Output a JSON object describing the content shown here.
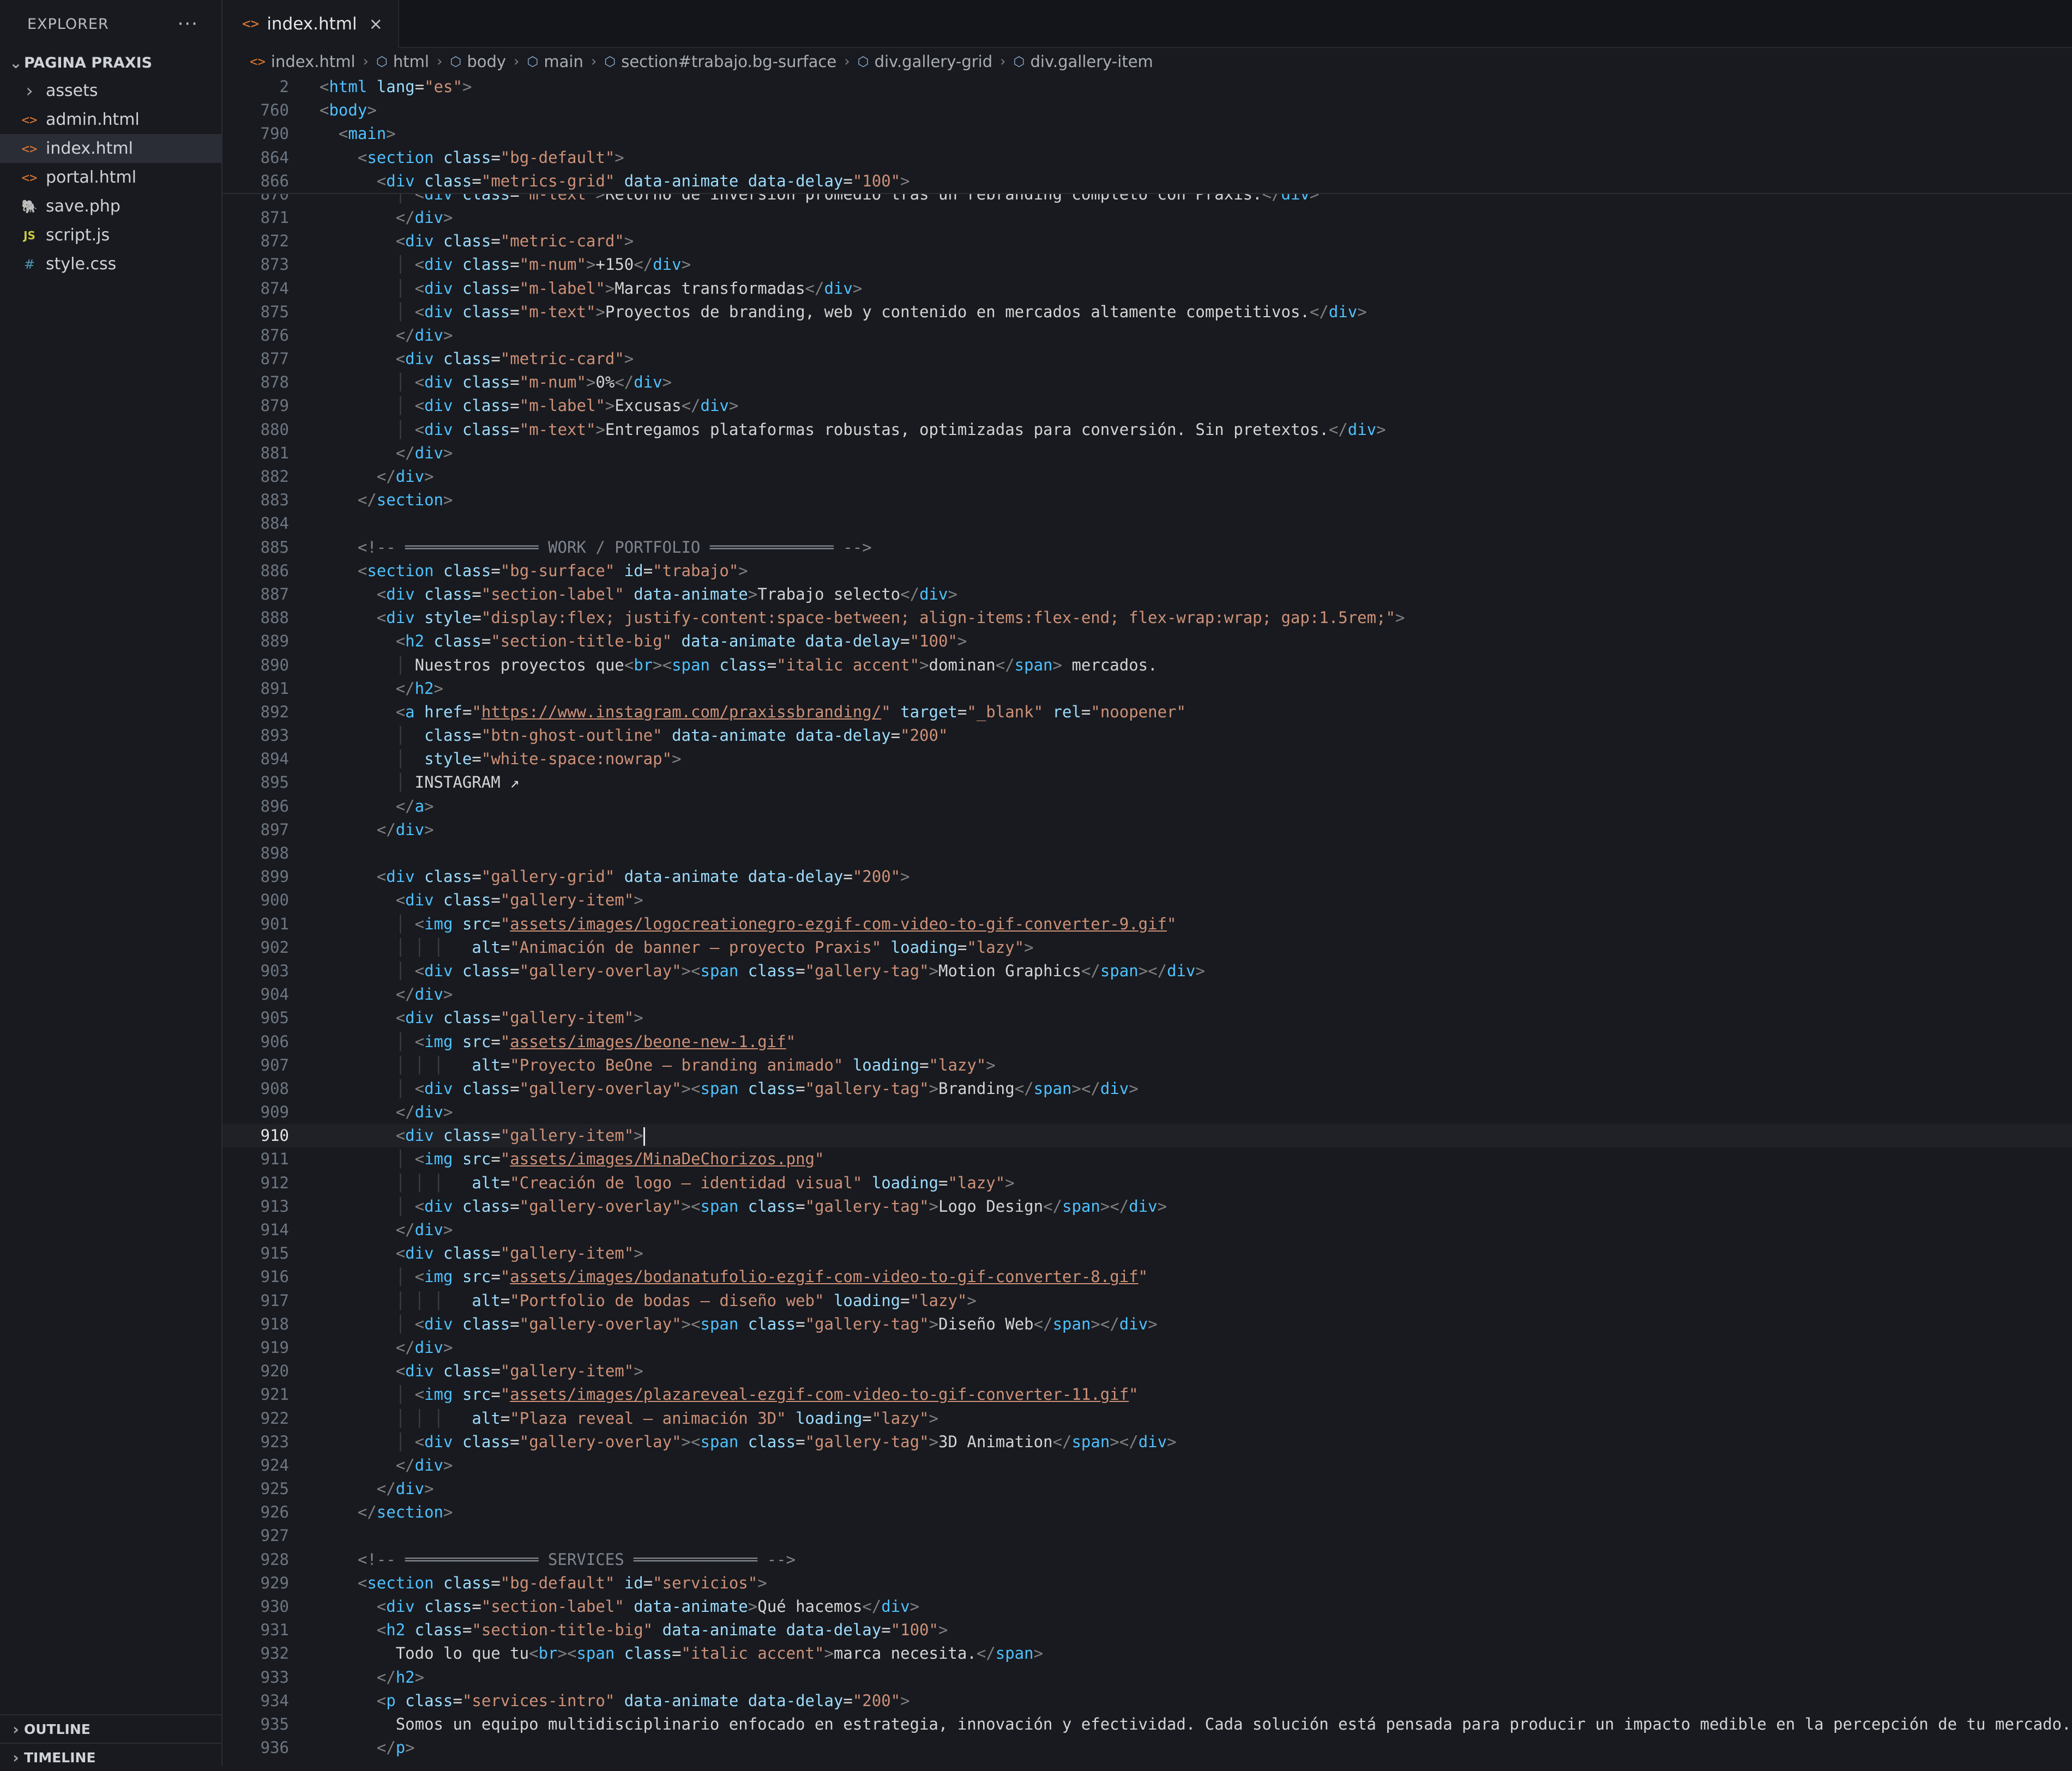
{
  "sidebar": {
    "title": "EXPLORER",
    "more": "···",
    "project": "PAGINA PRAXIS",
    "items": [
      {
        "name": "assets",
        "icon": "chevron-right-icon",
        "glyph": "›",
        "color": "#a0a4ab"
      },
      {
        "name": "admin.html",
        "icon": "html-icon",
        "glyph": "<>",
        "color": "#e37933"
      },
      {
        "name": "index.html",
        "icon": "html-icon",
        "glyph": "<>",
        "color": "#e37933"
      },
      {
        "name": "portal.html",
        "icon": "html-icon",
        "glyph": "<>",
        "color": "#e37933"
      },
      {
        "name": "save.php",
        "icon": "php-elephant-icon",
        "glyph": "🐘",
        "color": "#a074c4"
      },
      {
        "name": "script.js",
        "icon": "js-icon",
        "glyph": "JS",
        "color": "#cbcb41"
      },
      {
        "name": "style.css",
        "icon": "css-hash-icon",
        "glyph": "#",
        "color": "#519aba"
      }
    ],
    "active_index": 2,
    "outline": "OUTLINE",
    "timeline": "TIMELINE"
  },
  "tab": {
    "label": "index.html",
    "icon_glyph": "<>",
    "close": "×"
  },
  "breadcrumb": [
    {
      "label": "index.html",
      "icon": "html-icon"
    },
    {
      "label": "html",
      "icon": "element-icon"
    },
    {
      "label": "body",
      "icon": "element-icon"
    },
    {
      "label": "main",
      "icon": "element-icon"
    },
    {
      "label": "section#trabajo.bg-surface",
      "icon": "element-icon"
    },
    {
      "label": "div.gallery-grid",
      "icon": "element-icon"
    },
    {
      "label": "div.gallery-item",
      "icon": "element-icon"
    }
  ],
  "sticky_lines": [
    {
      "n": "2",
      "indent": 0,
      "code": "<html lang=\"es\">"
    },
    {
      "n": "760",
      "indent": 0,
      "code": "<body>"
    },
    {
      "n": "790",
      "indent": 1,
      "code": "<main>"
    },
    {
      "n": "864",
      "indent": 2,
      "code": "<section class=\"bg-default\">"
    },
    {
      "n": "866",
      "indent": 3,
      "code": "<div class=\"metrics-grid\" data-animate data-delay=\"100\">"
    }
  ],
  "partial_line": {
    "n": "870",
    "indent": 5,
    "code": "<div class=\"m-text\">Retorno de inversión promedio tras un rebranding completo con Praxis.</div>"
  },
  "current_line": "910",
  "lines": [
    {
      "n": "871",
      "indent": 4,
      "code": "</div>"
    },
    {
      "n": "872",
      "indent": 4,
      "code": "<div class=\"metric-card\">"
    },
    {
      "n": "873",
      "indent": 5,
      "code": "<div class=\"m-num\">+150</div>"
    },
    {
      "n": "874",
      "indent": 5,
      "code": "<div class=\"m-label\">Marcas transformadas</div>"
    },
    {
      "n": "875",
      "indent": 5,
      "code": "<div class=\"m-text\">Proyectos de branding, web y contenido en mercados altamente competitivos.</div>"
    },
    {
      "n": "876",
      "indent": 4,
      "code": "</div>"
    },
    {
      "n": "877",
      "indent": 4,
      "code": "<div class=\"metric-card\">"
    },
    {
      "n": "878",
      "indent": 5,
      "code": "<div class=\"m-num\">0%</div>"
    },
    {
      "n": "879",
      "indent": 5,
      "code": "<div class=\"m-label\">Excusas</div>"
    },
    {
      "n": "880",
      "indent": 5,
      "code": "<div class=\"m-text\">Entregamos plataformas robustas, optimizadas para conversión. Sin pretextos.</div>"
    },
    {
      "n": "881",
      "indent": 4,
      "code": "</div>"
    },
    {
      "n": "882",
      "indent": 3,
      "code": "</div>"
    },
    {
      "n": "883",
      "indent": 2,
      "code": "</section>"
    },
    {
      "n": "884",
      "indent": 0,
      "code": ""
    },
    {
      "n": "885",
      "indent": 2,
      "code": "<!-- ══════════════ WORK / PORTFOLIO ═════════════ -->"
    },
    {
      "n": "886",
      "indent": 2,
      "code": "<section class=\"bg-surface\" id=\"trabajo\">"
    },
    {
      "n": "887",
      "indent": 3,
      "code": "<div class=\"section-label\" data-animate>Trabajo selecto</div>"
    },
    {
      "n": "888",
      "indent": 3,
      "code": "<div style=\"display:flex; justify-content:space-between; align-items:flex-end; flex-wrap:wrap; gap:1.5rem;\">"
    },
    {
      "n": "889",
      "indent": 4,
      "code": "<h2 class=\"section-title-big\" data-animate data-delay=\"100\">"
    },
    {
      "n": "890",
      "indent": 5,
      "code": "Nuestros proyectos que<br><span class=\"italic accent\">dominan</span> mercados."
    },
    {
      "n": "891",
      "indent": 4,
      "code": "</h2>"
    },
    {
      "n": "892",
      "indent": 4,
      "code": "<a href=\"https://www.instagram.com/praxissbranding/\" target=\"_blank\" rel=\"noopener\""
    },
    {
      "n": "893",
      "indent": 5,
      "pad": " ",
      "code": "class=\"btn-ghost-outline\" data-animate data-delay=\"200\""
    },
    {
      "n": "894",
      "indent": 5,
      "pad": " ",
      "code": "style=\"white-space:nowrap\">"
    },
    {
      "n": "895",
      "indent": 5,
      "code": "INSTAGRAM ↗"
    },
    {
      "n": "896",
      "indent": 4,
      "code": "</a>"
    },
    {
      "n": "897",
      "indent": 3,
      "code": "</div>"
    },
    {
      "n": "898",
      "indent": 0,
      "code": ""
    },
    {
      "n": "899",
      "indent": 3,
      "code": "<div class=\"gallery-grid\" data-animate data-delay=\"200\">"
    },
    {
      "n": "900",
      "indent": 4,
      "code": "<div class=\"gallery-item\">"
    },
    {
      "n": "901",
      "indent": 5,
      "code": "<img src=\"assets/images/logocreationegro-ezgif-com-video-to-gif-converter-9.gif\""
    },
    {
      "n": "902",
      "indent": 7,
      "pad": "  ",
      "code": "alt=\"Animación de banner — proyecto Praxis\" loading=\"lazy\">"
    },
    {
      "n": "903",
      "indent": 5,
      "code": "<div class=\"gallery-overlay\"><span class=\"gallery-tag\">Motion Graphics</span></div>"
    },
    {
      "n": "904",
      "indent": 4,
      "code": "</div>"
    },
    {
      "n": "905",
      "indent": 4,
      "code": "<div class=\"gallery-item\">"
    },
    {
      "n": "906",
      "indent": 5,
      "code": "<img src=\"assets/images/beone-new-1.gif\""
    },
    {
      "n": "907",
      "indent": 7,
      "pad": "  ",
      "code": "alt=\"Proyecto BeOne — branding animado\" loading=\"lazy\">"
    },
    {
      "n": "908",
      "indent": 5,
      "code": "<div class=\"gallery-overlay\"><span class=\"gallery-tag\">Branding</span></div>"
    },
    {
      "n": "909",
      "indent": 4,
      "code": "</div>"
    },
    {
      "n": "910",
      "indent": 4,
      "code": "<div class=\"gallery-item\">",
      "cursor": true
    },
    {
      "n": "911",
      "indent": 5,
      "code": "<img src=\"assets/images/MinaDeChorizos.png\""
    },
    {
      "n": "912",
      "indent": 7,
      "pad": "  ",
      "code": "alt=\"Creación de logo — identidad visual\" loading=\"lazy\">"
    },
    {
      "n": "913",
      "indent": 5,
      "code": "<div class=\"gallery-overlay\"><span class=\"gallery-tag\">Logo Design</span></div>"
    },
    {
      "n": "914",
      "indent": 4,
      "code": "</div>"
    },
    {
      "n": "915",
      "indent": 4,
      "code": "<div class=\"gallery-item\">"
    },
    {
      "n": "916",
      "indent": 5,
      "code": "<img src=\"assets/images/bodanatufolio-ezgif-com-video-to-gif-converter-8.gif\""
    },
    {
      "n": "917",
      "indent": 7,
      "pad": "  ",
      "code": "alt=\"Portfolio de bodas — diseño web\" loading=\"lazy\">"
    },
    {
      "n": "918",
      "indent": 5,
      "code": "<div class=\"gallery-overlay\"><span class=\"gallery-tag\">Diseño Web</span></div>"
    },
    {
      "n": "919",
      "indent": 4,
      "code": "</div>"
    },
    {
      "n": "920",
      "indent": 4,
      "code": "<div class=\"gallery-item\">"
    },
    {
      "n": "921",
      "indent": 5,
      "code": "<img src=\"assets/images/plazareveal-ezgif-com-video-to-gif-converter-11.gif\""
    },
    {
      "n": "922",
      "indent": 7,
      "pad": "  ",
      "code": "alt=\"Plaza reveal — animación 3D\" loading=\"lazy\">"
    },
    {
      "n": "923",
      "indent": 5,
      "code": "<div class=\"gallery-overlay\"><span class=\"gallery-tag\">3D Animation</span></div>"
    },
    {
      "n": "924",
      "indent": 4,
      "code": "</div>"
    },
    {
      "n": "925",
      "indent": 3,
      "code": "</div>"
    },
    {
      "n": "926",
      "indent": 2,
      "code": "</section>"
    },
    {
      "n": "927",
      "indent": 0,
      "code": ""
    },
    {
      "n": "928",
      "indent": 2,
      "code": "<!-- ══════════════ SERVICES ═════════════ -->"
    },
    {
      "n": "929",
      "indent": 2,
      "code": "<section class=\"bg-default\" id=\"servicios\">"
    },
    {
      "n": "930",
      "indent": 3,
      "code": "<div class=\"section-label\" data-animate>Qué hacemos</div>"
    },
    {
      "n": "931",
      "indent": 3,
      "code": "<h2 class=\"section-title-big\" data-animate data-delay=\"100\">"
    },
    {
      "n": "932",
      "indent": 4,
      "code": "Todo lo que tu<br><span class=\"italic accent\">marca necesita.</span>"
    },
    {
      "n": "933",
      "indent": 3,
      "code": "</h2>"
    },
    {
      "n": "934",
      "indent": 3,
      "code": "<p class=\"services-intro\" data-animate data-delay=\"200\">"
    },
    {
      "n": "935",
      "indent": 4,
      "code": "Somos un equipo multidisciplinario enfocado en estrategia, innovación y efectividad. Cada solución está pensada para producir un impacto medible en la percepción de tu mercado."
    },
    {
      "n": "936",
      "indent": 3,
      "code": "</p>"
    }
  ]
}
